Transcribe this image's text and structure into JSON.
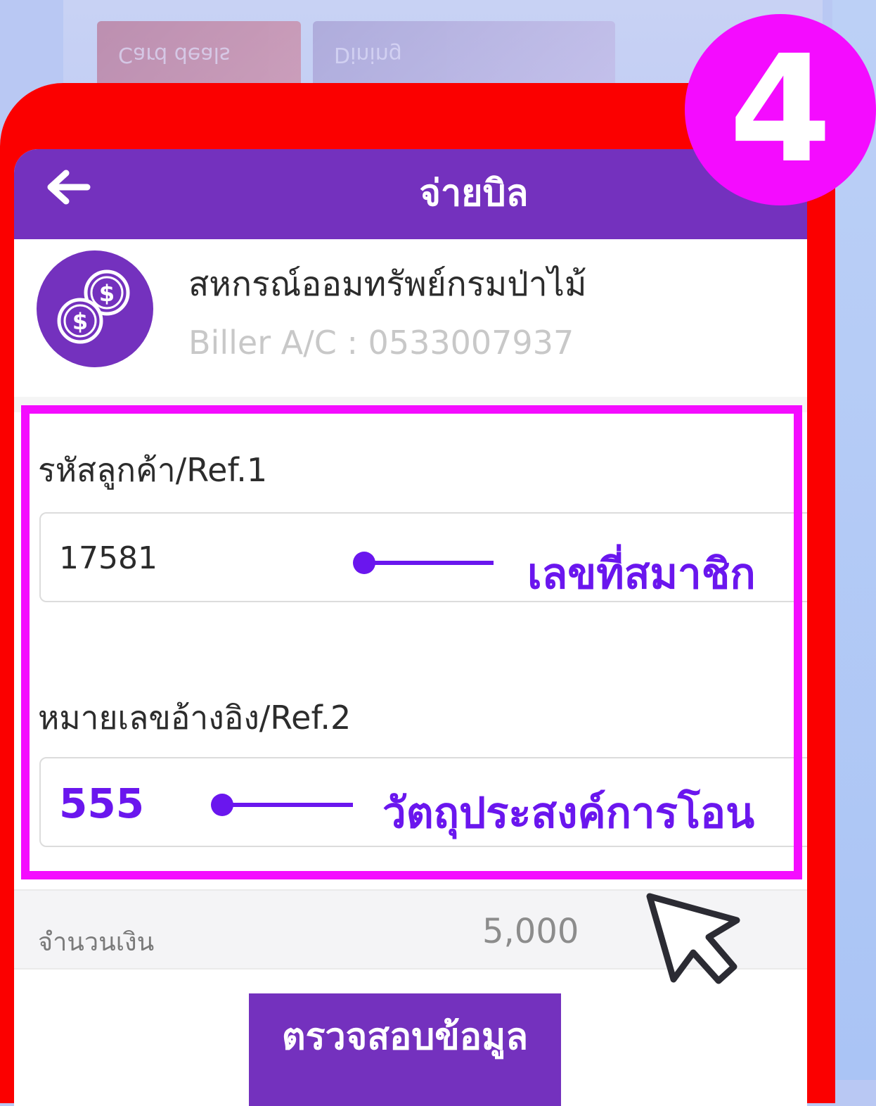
{
  "background": {
    "card1_text": "Card deals",
    "card2_text": "Dining"
  },
  "step": {
    "number": "4",
    "color": "#f40cff"
  },
  "header": {
    "title": "จ่ายบิล",
    "back_icon": "back-arrow-icon"
  },
  "biller": {
    "logo_icon": "coins-dollar-icon",
    "name": "สหกรณ์ออมทรัพย์กรมป่าไม้",
    "account": "Biller A/C : 0533007937"
  },
  "form": {
    "ref1": {
      "label": "รหัสลูกค้า/Ref.1",
      "value": "17581",
      "annotation": "เลขที่สมาชิก"
    },
    "ref2": {
      "label": "หมายเลขอ้างอิง/Ref.2",
      "value": "555",
      "annotation": "วัตถุประสงค์การโอน"
    }
  },
  "amount": {
    "label": "จำนวนเงิน",
    "value": "5,000"
  },
  "actions": {
    "verify_label": "ตรวจสอบข้อมูล"
  },
  "colors": {
    "brand_purple": "#7431be",
    "frame_red": "#fb0000",
    "annotation_purple": "#6a16ee",
    "highlight": "#f40cff"
  }
}
